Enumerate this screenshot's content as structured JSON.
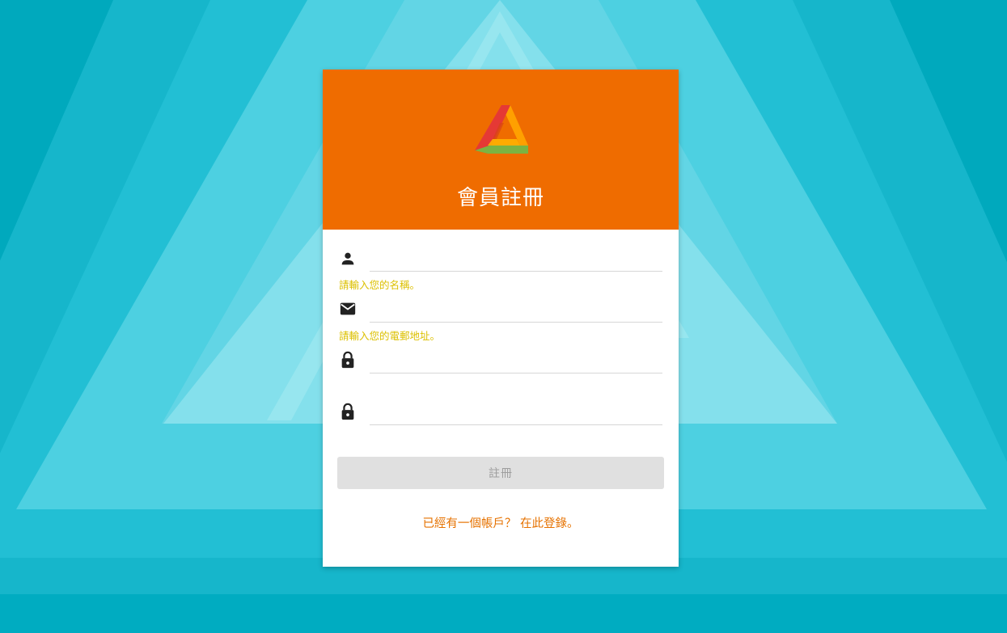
{
  "colors": {
    "header": "#ef6c00",
    "hint": "#dcc000",
    "link": "#e67200",
    "button_bg": "#e0e0e0",
    "background": "#27c2da"
  },
  "header": {
    "title": "會員註冊",
    "logo_icon": "triangle-logo-icon"
  },
  "form": {
    "name": {
      "icon": "person-icon",
      "value": "",
      "hint": "請輸入您的名稱。"
    },
    "email": {
      "icon": "mail-icon",
      "value": "",
      "hint": "請輸入您的電郵地址。"
    },
    "password": {
      "icon": "lock-icon",
      "value": ""
    },
    "confirm_password": {
      "icon": "lock-icon",
      "value": ""
    },
    "submit_label": "註冊"
  },
  "footer": {
    "login_text": "已經有一個帳戶？ 在此登錄。"
  }
}
